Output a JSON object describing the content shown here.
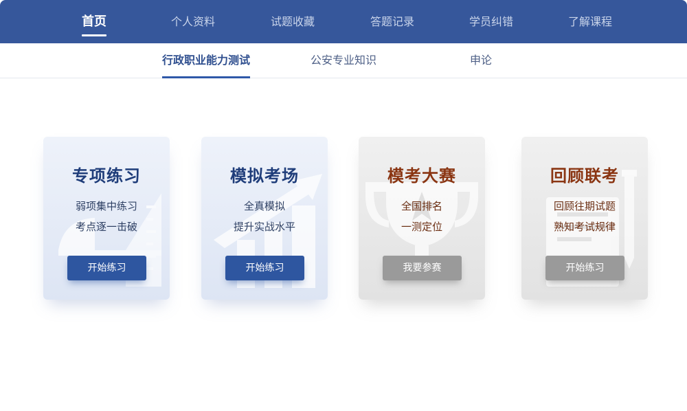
{
  "topnav": {
    "items": [
      {
        "label": "首页",
        "active": true
      },
      {
        "label": "个人资料"
      },
      {
        "label": "试题收藏"
      },
      {
        "label": "答题记录"
      },
      {
        "label": "学员纠错"
      },
      {
        "label": "了解课程"
      }
    ]
  },
  "subtabs": {
    "items": [
      {
        "label": "行政职业能力测试",
        "active": true
      },
      {
        "label": "公安专业知识"
      },
      {
        "label": "申论"
      }
    ]
  },
  "cards": [
    {
      "title": "专项练习",
      "line1": "弱项集中练习",
      "line2": "考点逐一击破",
      "button": "开始练习",
      "theme": "blue",
      "bg_icon": "ruler-icon"
    },
    {
      "title": "模拟考场",
      "line1": "全真模拟",
      "line2": "提升实战水平",
      "button": "开始练习",
      "theme": "blue",
      "bg_icon": "bar-chart-icon"
    },
    {
      "title": "模考大赛",
      "line1": "全国排名",
      "line2": "一测定位",
      "button": "我要参赛",
      "theme": "grey",
      "bg_icon": "trophy-icon"
    },
    {
      "title": "回顾联考",
      "line1": "回顾往期试题",
      "line2": "熟知考试规律",
      "button": "开始练习",
      "theme": "grey",
      "bg_icon": "paper-pen-icon"
    }
  ],
  "colors": {
    "nav_bg": "#36579b",
    "accent_blue": "#2e56a0",
    "card_title_blue": "#1f3d7a",
    "card_title_brown": "#8a3512",
    "button_grey": "#9a9a9a"
  }
}
